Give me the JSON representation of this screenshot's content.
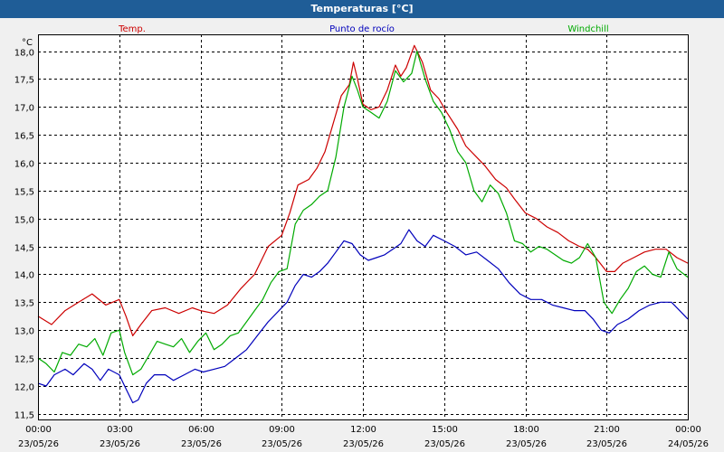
{
  "chart_data": {
    "type": "line",
    "title": "Temperaturas [°C]",
    "ylabel": "°C",
    "ylim": [
      11.4,
      18.3
    ],
    "yticks": [
      "11,5",
      "12,0",
      "12,5",
      "13,0",
      "13,5",
      "14,0",
      "14,5",
      "15,0",
      "15,5",
      "16,0",
      "16,5",
      "17,0",
      "17,5",
      "18,0"
    ],
    "ytick_values": [
      11.5,
      12.0,
      12.5,
      13.0,
      13.5,
      14.0,
      14.5,
      15.0,
      15.5,
      16.0,
      16.5,
      17.0,
      17.5,
      18.0
    ],
    "xlim": [
      0,
      24
    ],
    "xticks": [
      {
        "x": 0,
        "time": "00:00",
        "date": "23/05/26"
      },
      {
        "x": 3,
        "time": "03:00",
        "date": "23/05/26"
      },
      {
        "x": 6,
        "time": "06:00",
        "date": "23/05/26"
      },
      {
        "x": 9,
        "time": "09:00",
        "date": "23/05/26"
      },
      {
        "x": 12,
        "time": "12:00",
        "date": "23/05/26"
      },
      {
        "x": 15,
        "time": "15:00",
        "date": "23/05/26"
      },
      {
        "x": 18,
        "time": "18:00",
        "date": "23/05/26"
      },
      {
        "x": 21,
        "time": "21:00",
        "date": "23/05/26"
      },
      {
        "x": 24,
        "time": "00:00",
        "date": "24/05/26"
      }
    ],
    "grid": true,
    "legend": "top",
    "series": [
      {
        "name": "Temp.",
        "color": "#cc0000",
        "points": [
          [
            0,
            13.25
          ],
          [
            0.5,
            13.1
          ],
          [
            1.0,
            13.35
          ],
          [
            1.5,
            13.5
          ],
          [
            2.0,
            13.65
          ],
          [
            2.5,
            13.45
          ],
          [
            3.0,
            13.55
          ],
          [
            3.25,
            13.25
          ],
          [
            3.5,
            12.9
          ],
          [
            3.8,
            13.1
          ],
          [
            4.2,
            13.35
          ],
          [
            4.7,
            13.4
          ],
          [
            5.2,
            13.3
          ],
          [
            5.7,
            13.4
          ],
          [
            6.0,
            13.35
          ],
          [
            6.5,
            13.3
          ],
          [
            7.0,
            13.45
          ],
          [
            7.5,
            13.75
          ],
          [
            8.0,
            14.0
          ],
          [
            8.5,
            14.5
          ],
          [
            9.0,
            14.7
          ],
          [
            9.3,
            15.1
          ],
          [
            9.6,
            15.6
          ],
          [
            10.0,
            15.7
          ],
          [
            10.3,
            15.9
          ],
          [
            10.6,
            16.2
          ],
          [
            10.9,
            16.7
          ],
          [
            11.2,
            17.2
          ],
          [
            11.5,
            17.4
          ],
          [
            11.65,
            17.8
          ],
          [
            11.8,
            17.5
          ],
          [
            12.0,
            17.05
          ],
          [
            12.3,
            16.95
          ],
          [
            12.6,
            17.0
          ],
          [
            12.9,
            17.3
          ],
          [
            13.2,
            17.75
          ],
          [
            13.4,
            17.55
          ],
          [
            13.6,
            17.7
          ],
          [
            13.9,
            18.1
          ],
          [
            14.2,
            17.8
          ],
          [
            14.5,
            17.3
          ],
          [
            14.8,
            17.15
          ],
          [
            15.1,
            16.9
          ],
          [
            15.5,
            16.6
          ],
          [
            15.8,
            16.3
          ],
          [
            16.2,
            16.1
          ],
          [
            16.5,
            15.95
          ],
          [
            16.9,
            15.7
          ],
          [
            17.3,
            15.55
          ],
          [
            17.6,
            15.35
          ],
          [
            18.0,
            15.1
          ],
          [
            18.4,
            15.0
          ],
          [
            18.8,
            14.85
          ],
          [
            19.2,
            14.75
          ],
          [
            19.6,
            14.6
          ],
          [
            20.0,
            14.5
          ],
          [
            20.3,
            14.45
          ],
          [
            20.6,
            14.3
          ],
          [
            21.0,
            14.05
          ],
          [
            21.3,
            14.05
          ],
          [
            21.6,
            14.2
          ],
          [
            22.0,
            14.3
          ],
          [
            22.4,
            14.4
          ],
          [
            22.8,
            14.45
          ],
          [
            23.2,
            14.45
          ],
          [
            23.6,
            14.3
          ],
          [
            24.0,
            14.2
          ]
        ]
      },
      {
        "name": "Punto de rocío",
        "color": "#0000bb",
        "points": [
          [
            0,
            12.05
          ],
          [
            0.3,
            12.0
          ],
          [
            0.6,
            12.2
          ],
          [
            1.0,
            12.3
          ],
          [
            1.3,
            12.2
          ],
          [
            1.7,
            12.4
          ],
          [
            2.0,
            12.3
          ],
          [
            2.3,
            12.1
          ],
          [
            2.6,
            12.3
          ],
          [
            3.0,
            12.2
          ],
          [
            3.2,
            12.0
          ],
          [
            3.5,
            11.7
          ],
          [
            3.7,
            11.75
          ],
          [
            4.0,
            12.05
          ],
          [
            4.3,
            12.2
          ],
          [
            4.7,
            12.2
          ],
          [
            5.0,
            12.1
          ],
          [
            5.4,
            12.2
          ],
          [
            5.8,
            12.3
          ],
          [
            6.1,
            12.25
          ],
          [
            6.5,
            12.3
          ],
          [
            6.9,
            12.35
          ],
          [
            7.3,
            12.5
          ],
          [
            7.7,
            12.65
          ],
          [
            8.1,
            12.9
          ],
          [
            8.5,
            13.15
          ],
          [
            8.9,
            13.35
          ],
          [
            9.2,
            13.5
          ],
          [
            9.5,
            13.8
          ],
          [
            9.8,
            14.0
          ],
          [
            10.1,
            13.95
          ],
          [
            10.4,
            14.05
          ],
          [
            10.7,
            14.2
          ],
          [
            11.0,
            14.4
          ],
          [
            11.3,
            14.6
          ],
          [
            11.6,
            14.55
          ],
          [
            11.9,
            14.35
          ],
          [
            12.2,
            14.25
          ],
          [
            12.5,
            14.3
          ],
          [
            12.8,
            14.35
          ],
          [
            13.1,
            14.45
          ],
          [
            13.4,
            14.55
          ],
          [
            13.7,
            14.8
          ],
          [
            14.0,
            14.6
          ],
          [
            14.3,
            14.5
          ],
          [
            14.6,
            14.7
          ],
          [
            15.0,
            14.6
          ],
          [
            15.4,
            14.5
          ],
          [
            15.8,
            14.35
          ],
          [
            16.2,
            14.4
          ],
          [
            16.6,
            14.25
          ],
          [
            17.0,
            14.1
          ],
          [
            17.4,
            13.85
          ],
          [
            17.8,
            13.65
          ],
          [
            18.2,
            13.55
          ],
          [
            18.6,
            13.55
          ],
          [
            19.0,
            13.45
          ],
          [
            19.4,
            13.4
          ],
          [
            19.8,
            13.35
          ],
          [
            20.2,
            13.35
          ],
          [
            20.5,
            13.2
          ],
          [
            20.8,
            13.0
          ],
          [
            21.1,
            12.95
          ],
          [
            21.4,
            13.1
          ],
          [
            21.8,
            13.2
          ],
          [
            22.2,
            13.35
          ],
          [
            22.6,
            13.45
          ],
          [
            23.0,
            13.5
          ],
          [
            23.4,
            13.5
          ],
          [
            23.8,
            13.3
          ],
          [
            24.0,
            13.2
          ]
        ]
      },
      {
        "name": "Windchill",
        "color": "#00aa00",
        "points": [
          [
            0,
            12.5
          ],
          [
            0.3,
            12.4
          ],
          [
            0.6,
            12.25
          ],
          [
            0.9,
            12.6
          ],
          [
            1.2,
            12.55
          ],
          [
            1.5,
            12.75
          ],
          [
            1.8,
            12.7
          ],
          [
            2.1,
            12.85
          ],
          [
            2.4,
            12.55
          ],
          [
            2.7,
            12.95
          ],
          [
            3.0,
            13.0
          ],
          [
            3.2,
            12.6
          ],
          [
            3.5,
            12.2
          ],
          [
            3.8,
            12.3
          ],
          [
            4.1,
            12.55
          ],
          [
            4.4,
            12.8
          ],
          [
            4.7,
            12.75
          ],
          [
            5.0,
            12.7
          ],
          [
            5.3,
            12.85
          ],
          [
            5.6,
            12.6
          ],
          [
            5.9,
            12.8
          ],
          [
            6.2,
            12.95
          ],
          [
            6.5,
            12.65
          ],
          [
            6.8,
            12.75
          ],
          [
            7.1,
            12.9
          ],
          [
            7.4,
            12.95
          ],
          [
            7.7,
            13.15
          ],
          [
            8.0,
            13.35
          ],
          [
            8.3,
            13.55
          ],
          [
            8.6,
            13.85
          ],
          [
            8.9,
            14.05
          ],
          [
            9.2,
            14.1
          ],
          [
            9.5,
            14.9
          ],
          [
            9.8,
            15.15
          ],
          [
            10.1,
            15.25
          ],
          [
            10.4,
            15.4
          ],
          [
            10.7,
            15.5
          ],
          [
            11.0,
            16.1
          ],
          [
            11.3,
            17.0
          ],
          [
            11.6,
            17.55
          ],
          [
            11.8,
            17.3
          ],
          [
            12.0,
            17.0
          ],
          [
            12.3,
            16.9
          ],
          [
            12.6,
            16.8
          ],
          [
            12.9,
            17.1
          ],
          [
            13.2,
            17.65
          ],
          [
            13.5,
            17.45
          ],
          [
            13.8,
            17.6
          ],
          [
            14.0,
            18.0
          ],
          [
            14.3,
            17.5
          ],
          [
            14.6,
            17.1
          ],
          [
            14.9,
            16.9
          ],
          [
            15.2,
            16.6
          ],
          [
            15.5,
            16.2
          ],
          [
            15.8,
            16.0
          ],
          [
            16.1,
            15.5
          ],
          [
            16.4,
            15.3
          ],
          [
            16.7,
            15.6
          ],
          [
            17.0,
            15.45
          ],
          [
            17.3,
            15.1
          ],
          [
            17.6,
            14.6
          ],
          [
            17.9,
            14.55
          ],
          [
            18.2,
            14.4
          ],
          [
            18.5,
            14.5
          ],
          [
            18.8,
            14.45
          ],
          [
            19.1,
            14.35
          ],
          [
            19.4,
            14.25
          ],
          [
            19.7,
            14.2
          ],
          [
            20.0,
            14.3
          ],
          [
            20.3,
            14.55
          ],
          [
            20.6,
            14.3
          ],
          [
            20.9,
            13.5
          ],
          [
            21.2,
            13.3
          ],
          [
            21.5,
            13.55
          ],
          [
            21.8,
            13.75
          ],
          [
            22.1,
            14.05
          ],
          [
            22.4,
            14.15
          ],
          [
            22.7,
            14.0
          ],
          [
            23.0,
            13.95
          ],
          [
            23.3,
            14.4
          ],
          [
            23.6,
            14.1
          ],
          [
            24.0,
            13.95
          ]
        ]
      }
    ]
  }
}
